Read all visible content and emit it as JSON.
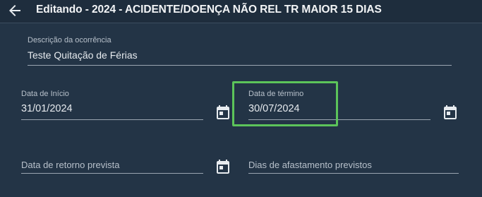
{
  "header": {
    "title": "Editando - 2024 - ACIDENTE/DOENÇA NÃO REL TR MAIOR 15 DIAS",
    "back_icon": "arrow-left-icon"
  },
  "form": {
    "description": {
      "label": "Descrição da ocorrência",
      "value": "Teste Quitação de Férias"
    },
    "start_date": {
      "label": "Data de Início",
      "value": "31/01/2024",
      "icon": "calendar-icon"
    },
    "end_date": {
      "label": "Data de término",
      "value": "30/07/2024",
      "icon": "calendar-icon"
    },
    "return_date": {
      "placeholder": "Data de retorno prevista",
      "icon": "calendar-icon"
    },
    "leave_days": {
      "placeholder": "Dias de afastamento previstos"
    }
  },
  "colors": {
    "background": "#233446",
    "highlight": "#5cc45a"
  }
}
